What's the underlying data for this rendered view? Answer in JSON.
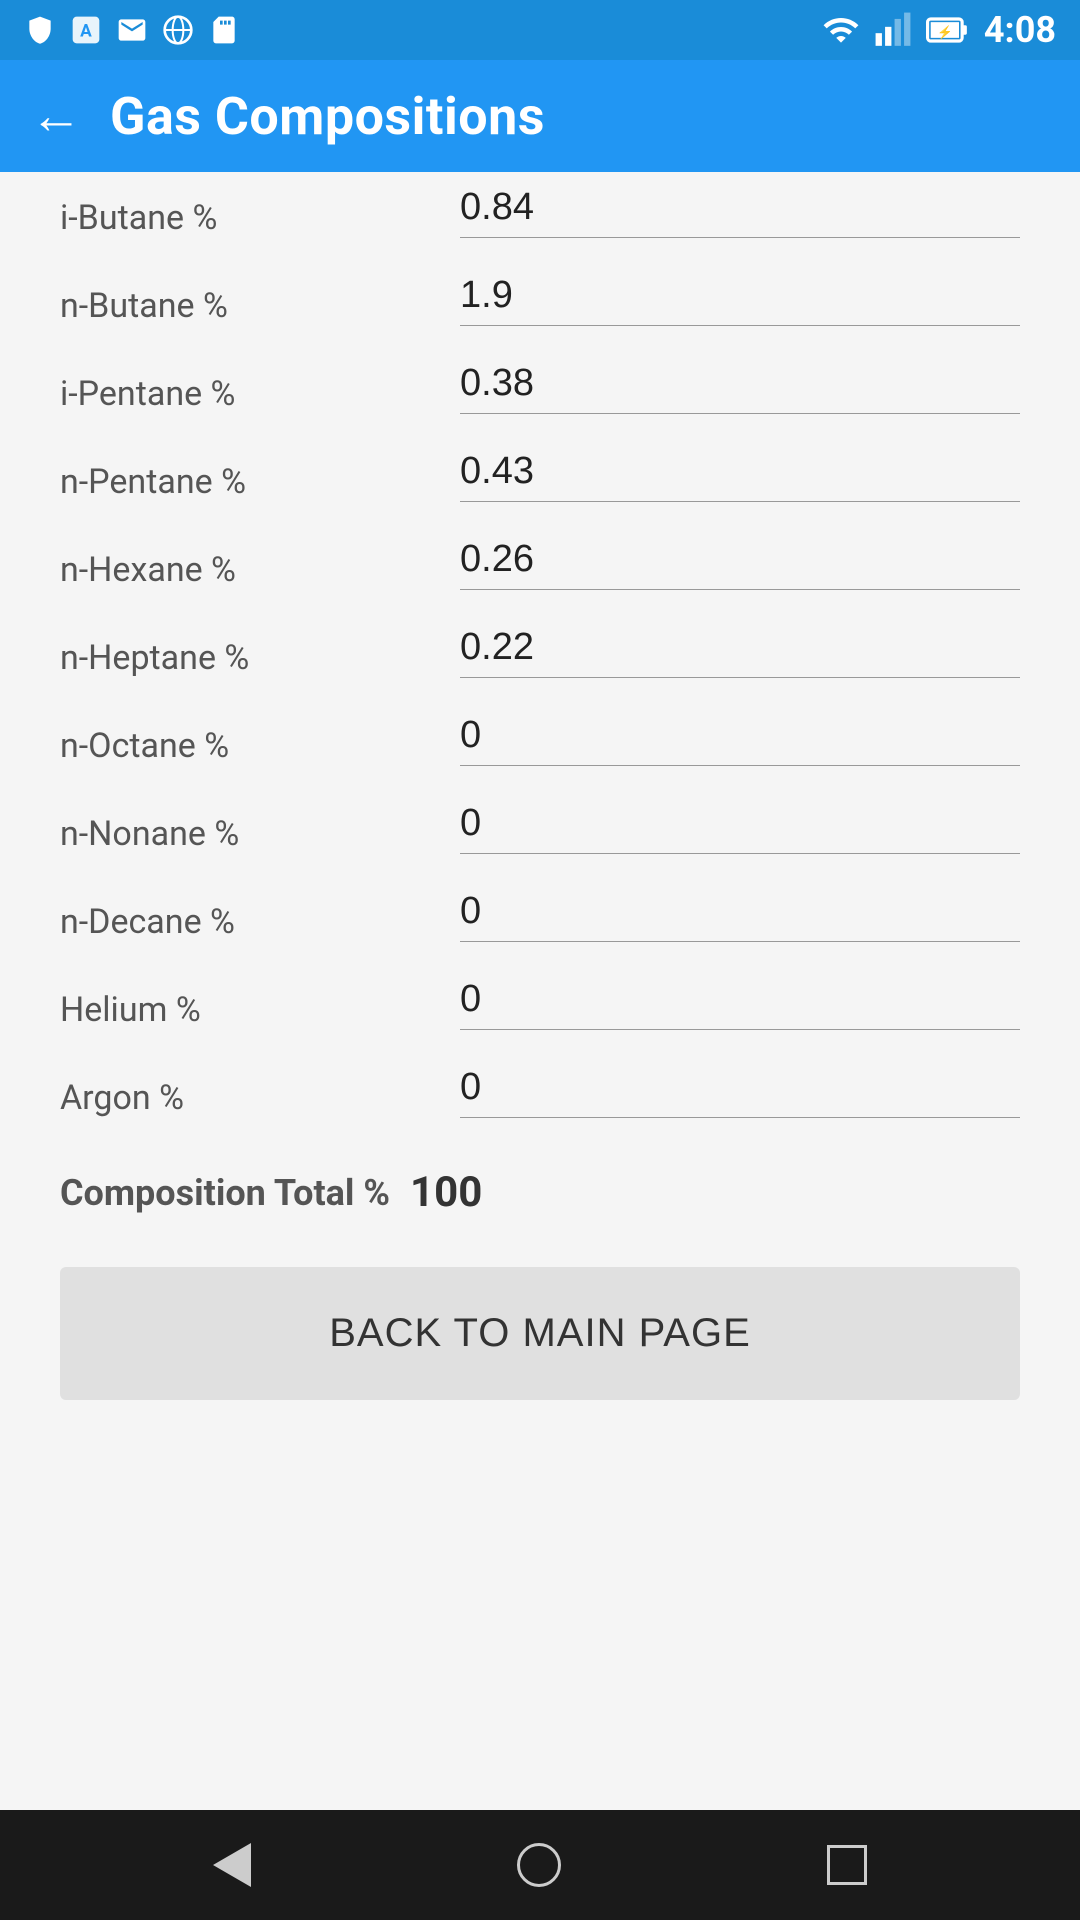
{
  "statusBar": {
    "time": "4:08"
  },
  "appBar": {
    "backLabel": "←",
    "title": "Gas Compositions"
  },
  "fields": [
    {
      "id": "i-butane",
      "label": "i-Butane %",
      "value": "0.84",
      "partial": true
    },
    {
      "id": "n-butane",
      "label": "n-Butane %",
      "value": "1.9",
      "partial": false
    },
    {
      "id": "i-pentane",
      "label": "i-Pentane %",
      "value": "0.38",
      "partial": false
    },
    {
      "id": "n-pentane",
      "label": "n-Pentane %",
      "value": "0.43",
      "partial": false
    },
    {
      "id": "n-hexane",
      "label": "n-Hexane %",
      "value": "0.26",
      "partial": false
    },
    {
      "id": "n-heptane",
      "label": "n-Heptane %",
      "value": "0.22",
      "partial": false
    },
    {
      "id": "n-octane",
      "label": "n-Octane %",
      "value": "0",
      "partial": false
    },
    {
      "id": "n-nonane",
      "label": "n-Nonane %",
      "value": "0",
      "partial": false
    },
    {
      "id": "n-decane",
      "label": "n-Decane %",
      "value": "0",
      "partial": false
    },
    {
      "id": "helium",
      "label": "Helium %",
      "value": "0",
      "partial": false
    },
    {
      "id": "argon",
      "label": "Argon %",
      "value": "0",
      "partial": false
    }
  ],
  "compositionTotal": {
    "label": "Composition Total %",
    "value": "100"
  },
  "backButton": {
    "label": "BACK TO MAIN PAGE"
  }
}
